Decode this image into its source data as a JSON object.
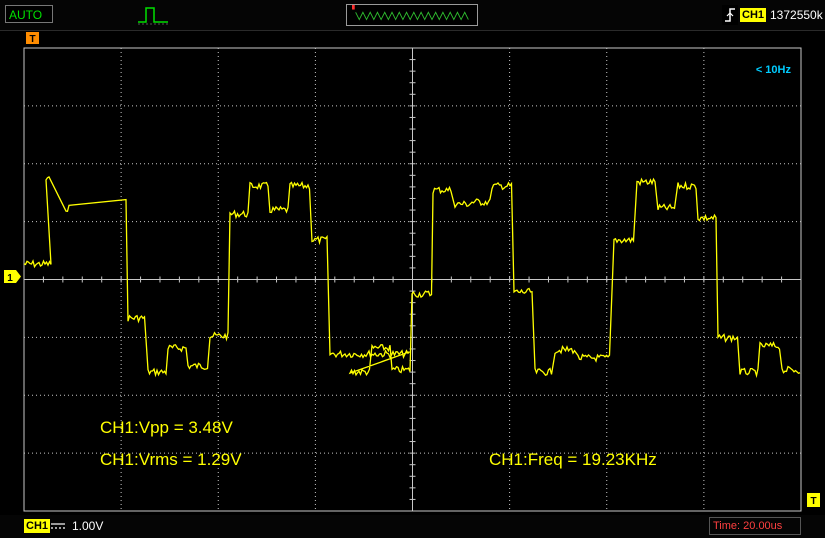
{
  "topbar": {
    "mode_label": "AUTO",
    "pulse_icon": "single-pulse-icon",
    "trigger_edge_icon": "rising-edge-icon",
    "trigger_channel": "CH1",
    "trigger_value": "1372550k"
  },
  "screen": {
    "freq_hint": "< 10Hz",
    "trigger_marker": "T",
    "channel_marker": "1",
    "trigger_time_marker": "T"
  },
  "measurements": {
    "vpp": "CH1:Vpp = 3.48V",
    "vrms": "CH1:Vrms = 1.29V",
    "freq": "CH1:Freq = 19.23KHz"
  },
  "bottombar": {
    "channel": "CH1",
    "coupling_icon": "dc-coupling-icon",
    "scale": "1.00V",
    "timebase": "Time: 20.00us"
  },
  "colors": {
    "trace": "#ffff00",
    "grid": "#c8c8c8",
    "mode_text": "#00e000",
    "timebase_text": "#ff4040",
    "hint_text": "#00ccff",
    "marker": "#ff8c00"
  }
}
